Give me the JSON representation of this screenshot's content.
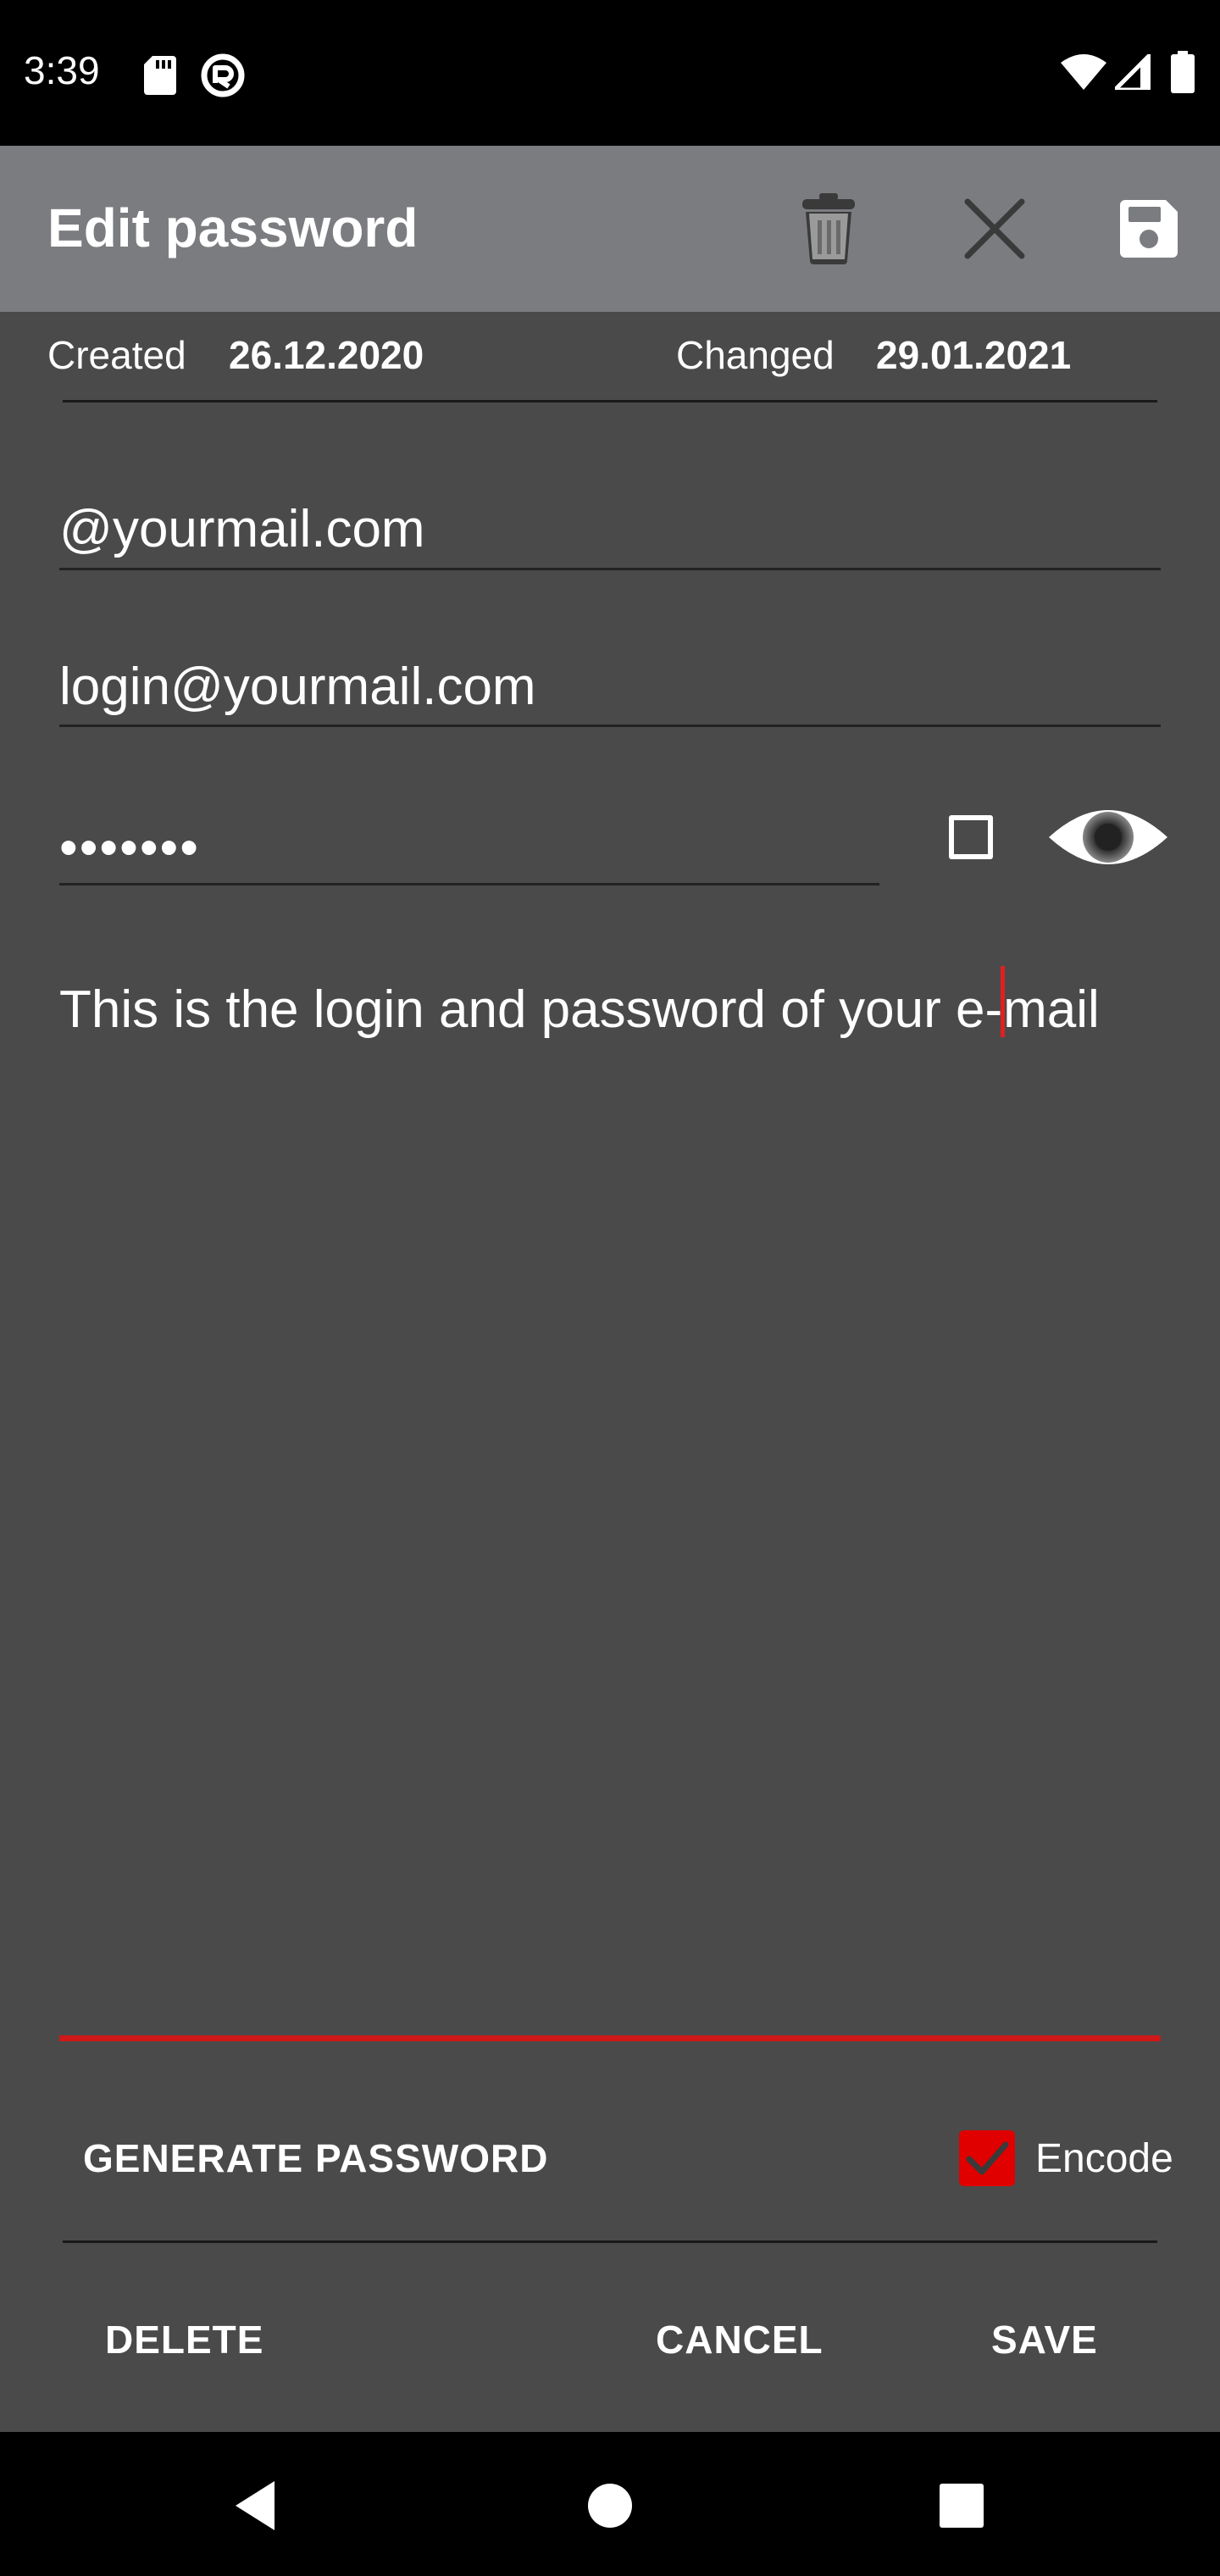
{
  "status_bar": {
    "time": "3:39",
    "icons": [
      "sd-card-icon",
      "vpn-icon",
      "wifi-icon",
      "signal-icon",
      "battery-icon"
    ]
  },
  "app_bar": {
    "title": "Edit password",
    "actions": [
      "trash-icon",
      "close-icon",
      "save-icon"
    ]
  },
  "meta": {
    "created_label": "Created",
    "created_value": "26.12.2020",
    "changed_label": "Changed",
    "changed_value": "29.01.2021"
  },
  "form": {
    "site": "@yourmail.com",
    "login": "login@yourmail.com",
    "password_masked": "•••••••",
    "notes_before_cursor": "This is the login and password of your e-",
    "notes_after_cursor": "mail"
  },
  "actions": {
    "generate_password": "GENERATE PASSWORD",
    "encode_label": "Encode",
    "encode_checked": true,
    "delete": "DELETE",
    "cancel": "CANCEL",
    "save": "SAVE"
  },
  "colors": {
    "background": "#4a4a4a",
    "app_bar": "#7b7c80",
    "accent": "#e00000"
  },
  "nav_bar": {
    "icons": [
      "back-icon",
      "home-icon",
      "recents-icon"
    ]
  }
}
